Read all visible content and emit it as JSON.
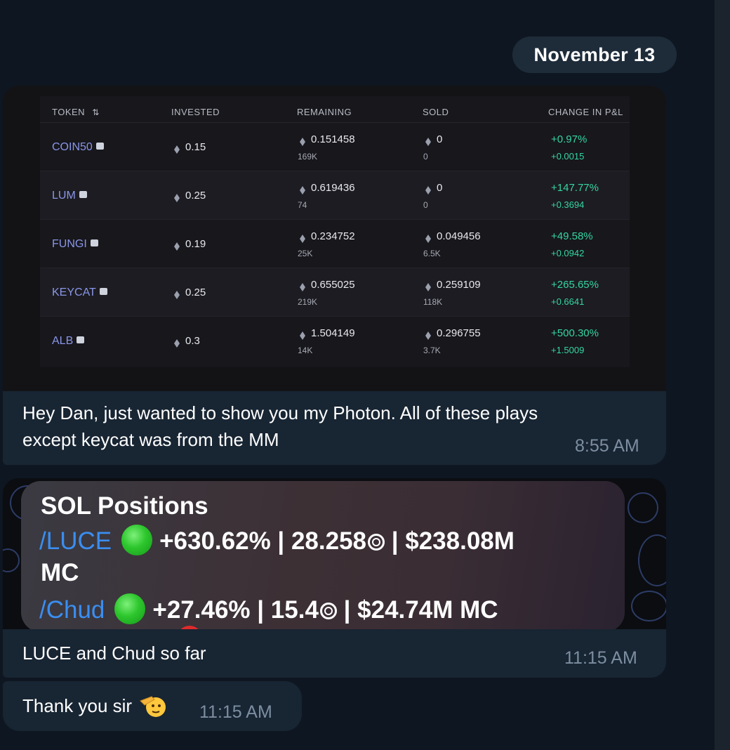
{
  "date_separator": "November 13",
  "message1": {
    "table": {
      "headers": {
        "token": "TOKEN",
        "invested": "INVESTED",
        "remaining": "REMAINING",
        "sold": "SOLD",
        "change": "CHANGE IN P&L"
      },
      "sort_icon": "sort-arrows-icon",
      "rows": [
        {
          "token": "COIN50",
          "invested": "0.15",
          "remaining": "0.151458",
          "remaining_sub": "169K",
          "sold": "0",
          "sold_sub": "0",
          "pnl": "+0.97%",
          "pnl_sub": "+0.0015"
        },
        {
          "token": "LUM",
          "invested": "0.25",
          "remaining": "0.619436",
          "remaining_sub": "74",
          "sold": "0",
          "sold_sub": "0",
          "pnl": "+147.77%",
          "pnl_sub": "+0.3694"
        },
        {
          "token": "FUNGI",
          "invested": "0.19",
          "remaining": "0.234752",
          "remaining_sub": "25K",
          "sold": "0.049456",
          "sold_sub": "6.5K",
          "pnl": "+49.58%",
          "pnl_sub": "+0.0942"
        },
        {
          "token": "KEYCAT",
          "invested": "0.25",
          "remaining": "0.655025",
          "remaining_sub": "219K",
          "sold": "0.259109",
          "sold_sub": "118K",
          "pnl": "+265.65%",
          "pnl_sub": "+0.6641"
        },
        {
          "token": "ALB",
          "invested": "0.3",
          "remaining": "1.504149",
          "remaining_sub": "14K",
          "sold": "0.296755",
          "sold_sub": "3.7K",
          "pnl": "+500.30%",
          "pnl_sub": "+1.5009"
        }
      ]
    },
    "text_line1": "Hey Dan, just wanted to show you my Photon. All of these plays",
    "text_line2": "except keycat was from the MM",
    "time": "8:55 AM"
  },
  "message2": {
    "image": {
      "title": "SOL Positions",
      "line1_link": "/LUCE",
      "line1_rest": "+630.62% | 28.258",
      "line1_tail": " | $238.08M",
      "line1_wrap": "MC",
      "line2_link": "/Chud",
      "line2_rest": "+27.46% | 15.4",
      "line2_tail": " | $24.74M MC"
    },
    "caption": "LUCE and Chud so far",
    "time": "11:15 AM"
  },
  "message3": {
    "text": "Thank you sir",
    "emoji": "saluting-face-icon",
    "time": "11:15 AM"
  },
  "colors": {
    "background": "#0e1621",
    "bubble": "#182533",
    "link": "#3a8ef0",
    "positive": "#35d6a0",
    "token": "#8a96e8"
  }
}
